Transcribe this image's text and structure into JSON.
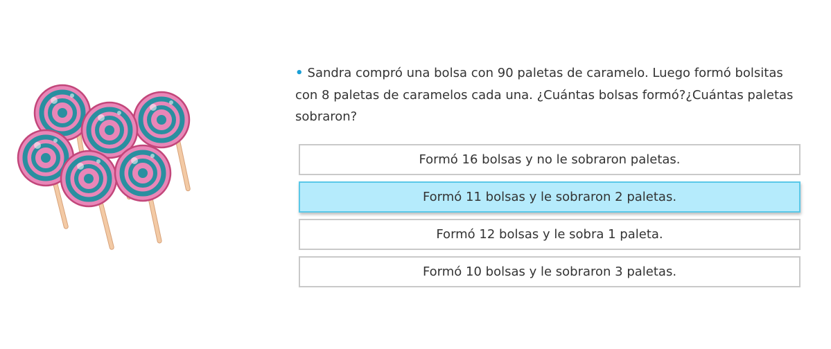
{
  "question": {
    "text": "Sandra compró una bolsa con 90 paletas de caramelo. Luego formó bolsitas con 8 paletas de caramelos cada una. ¿Cuántas bolsas formó?¿Cuántas paletas sobraron?",
    "bullet": "•"
  },
  "options": [
    {
      "label": "Formó 16 bolsas y no le sobraron paletas.",
      "selected": false
    },
    {
      "label": "Formó 11 bolsas y le sobraron 2 paletas.",
      "selected": true
    },
    {
      "label": "Formó 12 bolsas y le sobra 1 paleta.",
      "selected": false
    },
    {
      "label": "Formó 10 bolsas y le sobraron 3 paletas.",
      "selected": false
    }
  ],
  "illustration": {
    "icon": "lollipops-icon",
    "colors": {
      "candy": "#e986b8",
      "swirl": "#2a8fa0",
      "outline": "#c2467a",
      "stick": "#f3caa5"
    }
  },
  "colors": {
    "bullet": "#1a9fd6",
    "selected_bg": "#b5ebfc",
    "selected_border": "#5ac8e8",
    "option_border": "#c9c9c9"
  }
}
